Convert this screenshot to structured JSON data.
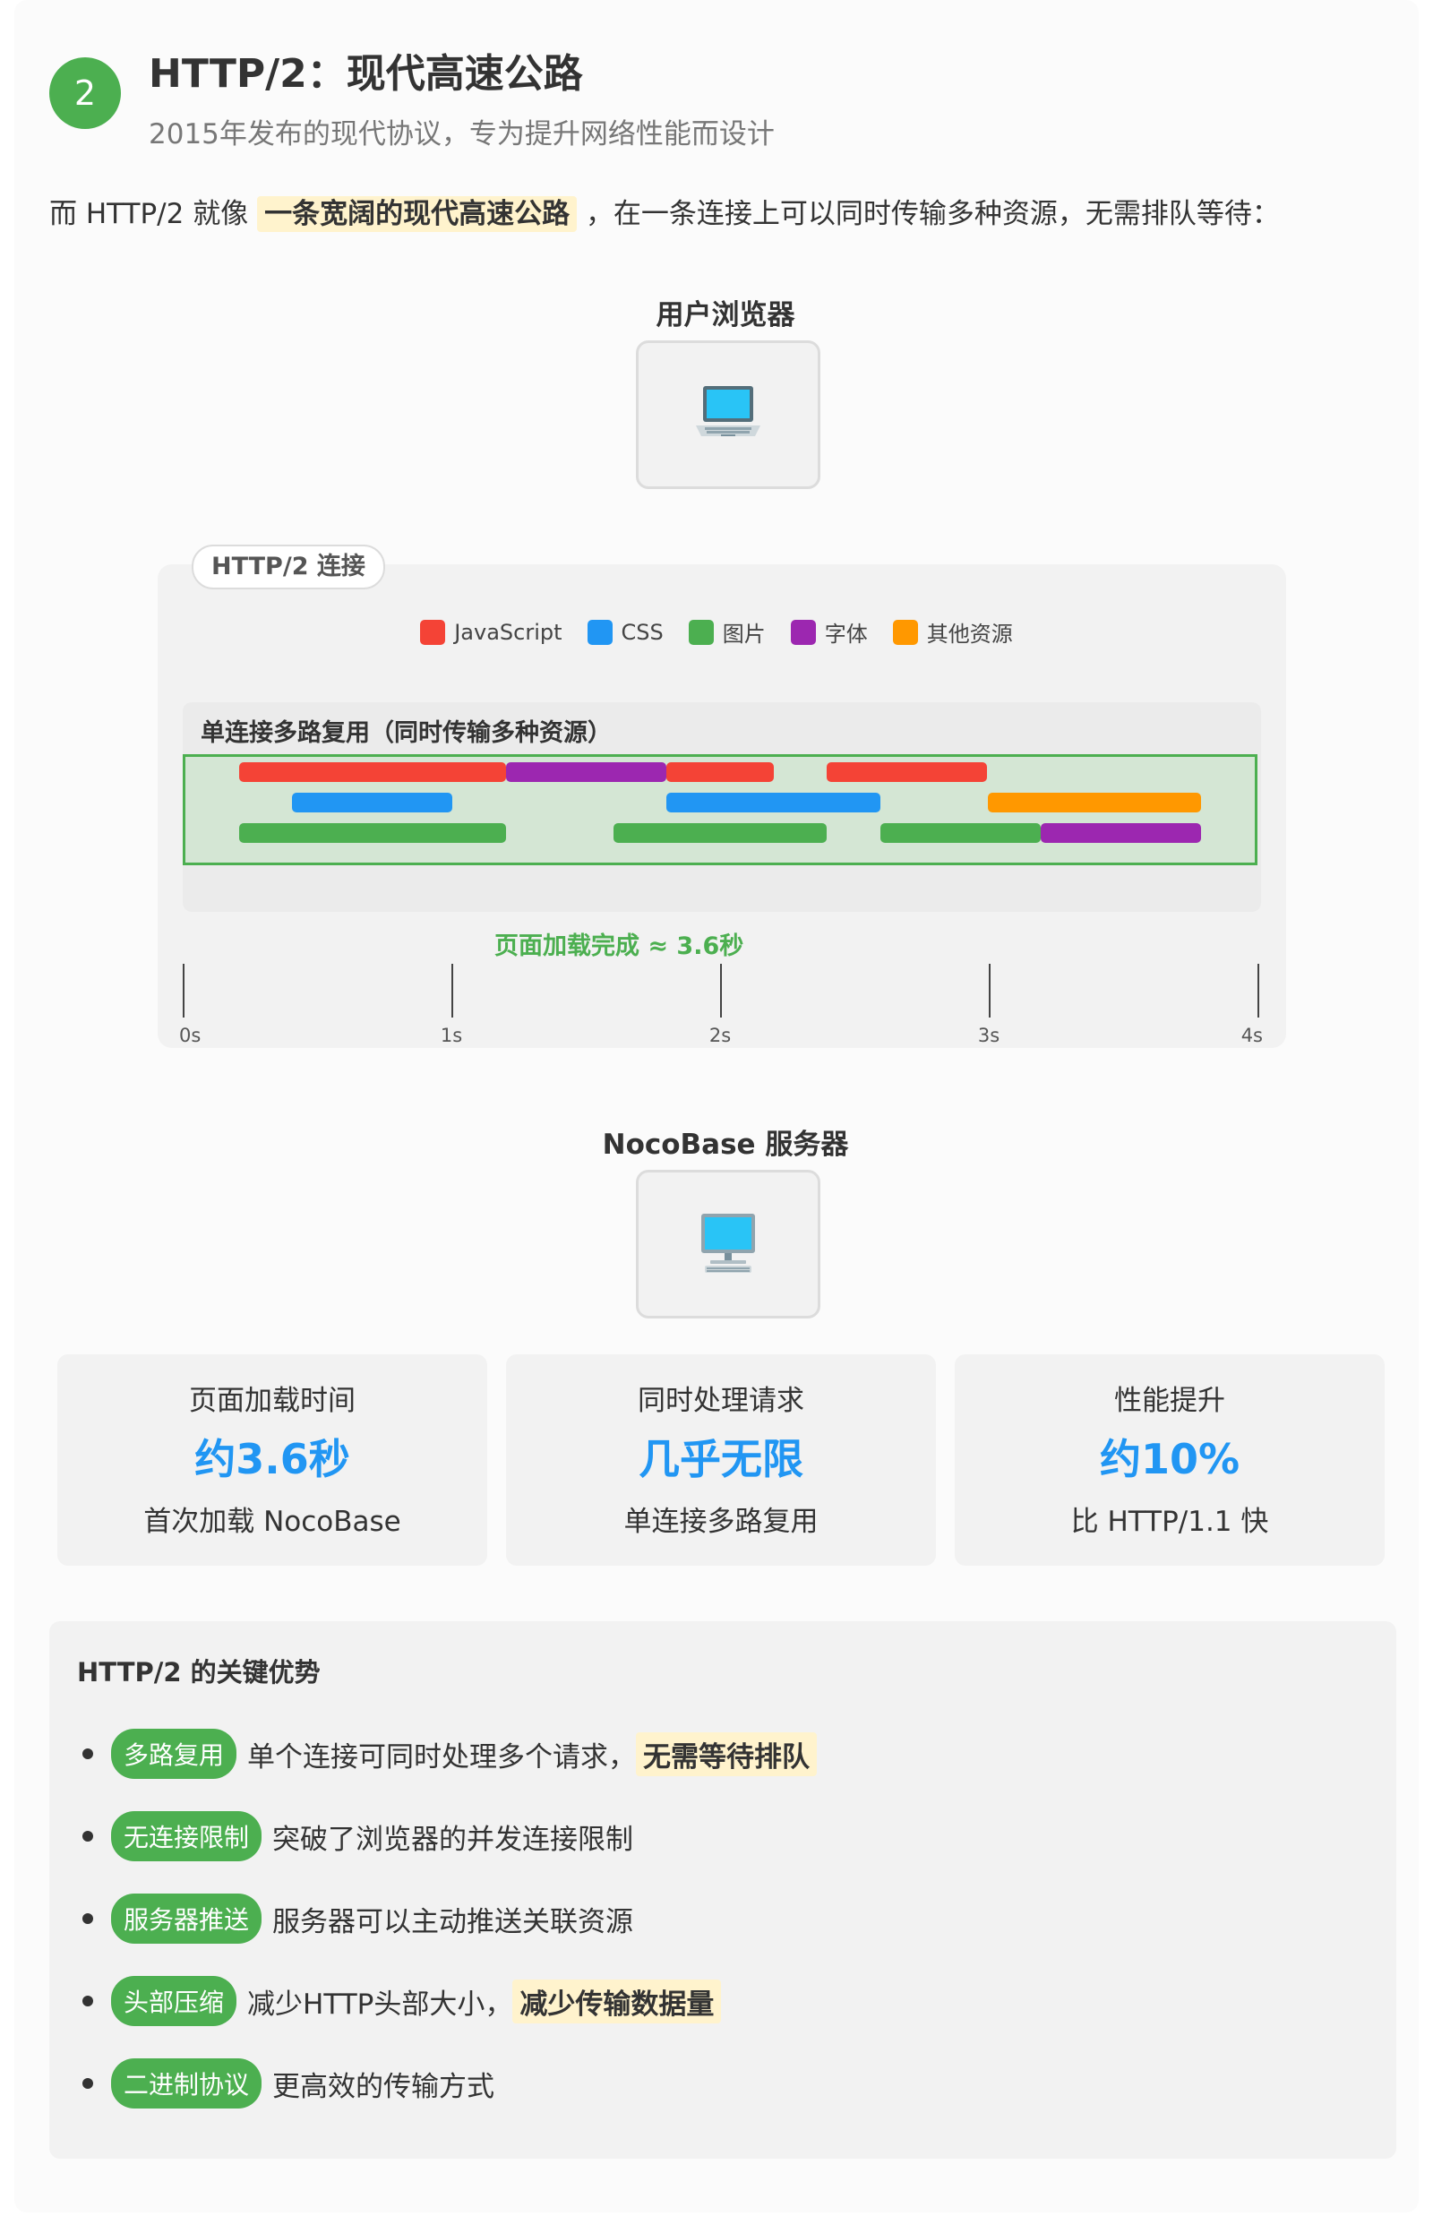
{
  "header": {
    "step_number": "2",
    "title": "HTTP/2：现代高速公路",
    "subtitle": "2015年发布的现代协议，专为提升网络性能而设计"
  },
  "intro": {
    "before": "而 HTTP/2 就像",
    "highlight": "一条宽阔的现代高速公路",
    "after": "，在一条连接上可以同时传输多种资源，无需排队等待："
  },
  "client": {
    "label": "用户浏览器",
    "icon": "laptop-icon"
  },
  "server": {
    "label": "NocoBase 服务器",
    "icon": "desktop-computer-icon"
  },
  "connection": {
    "tag": "HTTP/2 连接",
    "lane_title": "单连接多路复用（同时传输多种资源）",
    "done_label": "页面加载完成 ≈ 3.6秒"
  },
  "chart_data": {
    "type": "timeline",
    "x_unit": "s",
    "xlim": [
      0,
      4
    ],
    "ticks": [
      "0s",
      "1s",
      "2s",
      "3s",
      "4s"
    ],
    "legend": [
      {
        "name": "JavaScript",
        "color": "#f44336"
      },
      {
        "name": "CSS",
        "color": "#2196f3"
      },
      {
        "name": "图片",
        "color": "#4caf50"
      },
      {
        "name": "字体",
        "color": "#9c27b0"
      },
      {
        "name": "其他资源",
        "color": "#ff9800"
      }
    ],
    "segments": [
      {
        "series": "JavaScript",
        "row": 0,
        "start": 0.2,
        "end": 1.2
      },
      {
        "series": "字体",
        "row": 0,
        "start": 1.2,
        "end": 1.8
      },
      {
        "series": "JavaScript",
        "row": 0,
        "start": 1.8,
        "end": 2.2
      },
      {
        "series": "JavaScript",
        "row": 0,
        "start": 2.4,
        "end": 3.0
      },
      {
        "series": "CSS",
        "row": 1,
        "start": 0.4,
        "end": 1.0
      },
      {
        "series": "CSS",
        "row": 1,
        "start": 1.8,
        "end": 2.6
      },
      {
        "series": "其他资源",
        "row": 1,
        "start": 3.0,
        "end": 3.8
      },
      {
        "series": "图片",
        "row": 2,
        "start": 0.2,
        "end": 1.2
      },
      {
        "series": "图片",
        "row": 2,
        "start": 1.6,
        "end": 2.4
      },
      {
        "series": "图片",
        "row": 2,
        "start": 2.6,
        "end": 3.2
      },
      {
        "series": "字体",
        "row": 2,
        "start": 3.2,
        "end": 3.8
      }
    ],
    "page_load_complete": 3.6
  },
  "stats": [
    {
      "label": "页面加载时间",
      "value": "约3.6秒",
      "desc": "首次加载 NocoBase"
    },
    {
      "label": "同时处理请求",
      "value": "几乎无限",
      "desc": "单连接多路复用"
    },
    {
      "label": "性能提升",
      "value": "约10%",
      "desc": "比 HTTP/1.1 快"
    }
  ],
  "advantages": {
    "title": "HTTP/2 的关键优势",
    "items": [
      {
        "tag": "多路复用",
        "text": "单个连接可同时处理多个请求，",
        "highlight": "无需等待排队"
      },
      {
        "tag": "无连接限制",
        "text": "突破了浏览器的并发连接限制",
        "highlight": ""
      },
      {
        "tag": "服务器推送",
        "text": "服务器可以主动推送关联资源",
        "highlight": ""
      },
      {
        "tag": "头部压缩",
        "text": "减少HTTP头部大小，",
        "highlight": "减少传输数据量"
      },
      {
        "tag": "二进制协议",
        "text": "更高效的传输方式",
        "highlight": ""
      }
    ]
  },
  "colors": {
    "accent_green": "#4caf50",
    "value_blue": "#2196f3",
    "highlight_bg": "#fff3cd"
  }
}
